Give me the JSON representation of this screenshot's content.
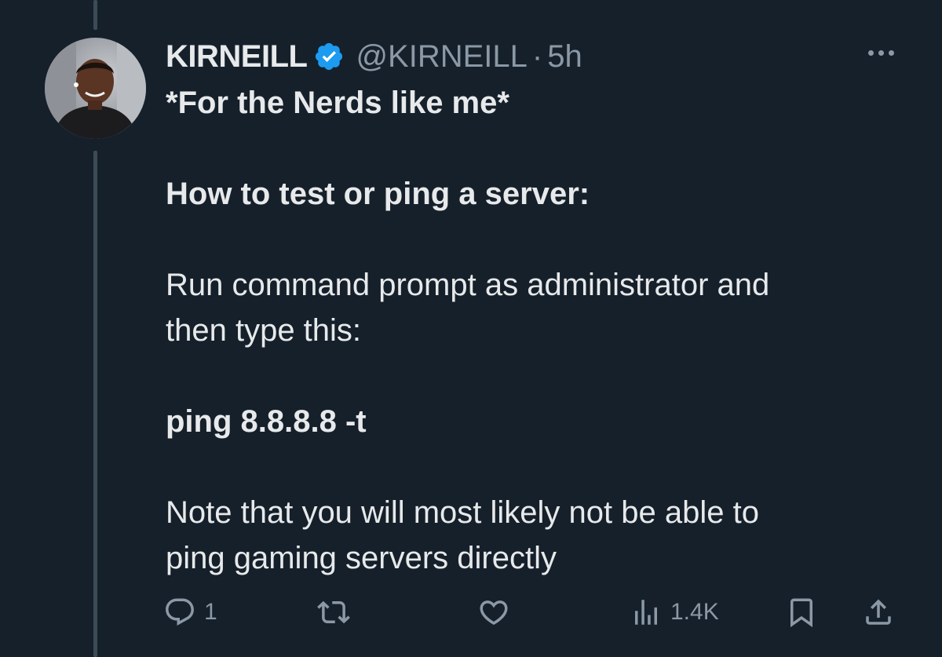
{
  "tweet": {
    "display_name": "KIRNEILL",
    "handle": "@KIRNEILL",
    "separator": "·",
    "time": "5h",
    "lines": {
      "l1": "*For the Nerds like me*",
      "l2": "How to test or ping a server:",
      "l3": "Run command prompt as administrator and",
      "l4": "then type this:",
      "l5": "ping 8.8.8.8 -t",
      "l6": "Note that you will most likely not be able to",
      "l7": "ping gaming servers directly"
    }
  },
  "actions": {
    "reply_count": "1",
    "views_count": "1.4K"
  },
  "colors": {
    "background": "#15202b",
    "text": "#e7e9ea",
    "muted": "#8b98a5",
    "verified": "#1d9bf0"
  },
  "icons": [
    "verified-badge-icon",
    "more-icon",
    "reply-icon",
    "retweet-icon",
    "like-icon",
    "views-icon",
    "bookmark-icon",
    "share-icon"
  ]
}
